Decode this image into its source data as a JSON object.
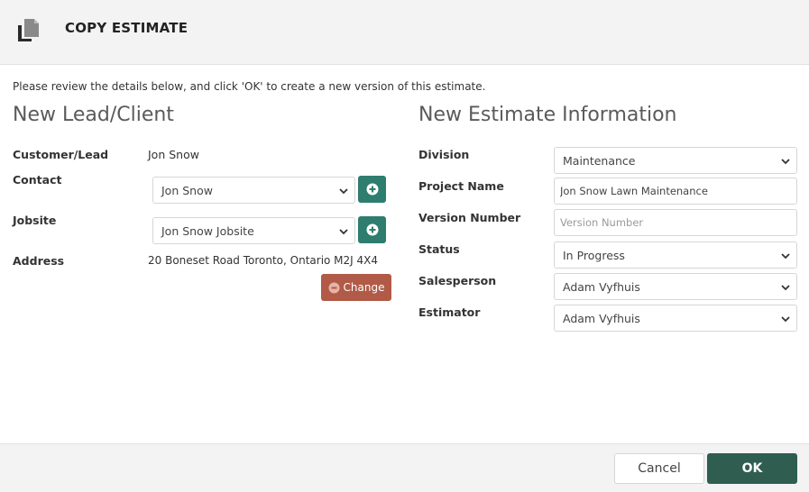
{
  "dialog": {
    "title": "COPY ESTIMATE",
    "icon": "copy-document-icon",
    "intro": "Please review the details below, and click 'OK' to create a new version of this estimate."
  },
  "lead_client": {
    "heading": "New Lead/Client",
    "customer_label": "Customer/Lead",
    "customer_value": "Jon Snow",
    "contact_label": "Contact",
    "contact_value": "Jon Snow",
    "jobsite_label": "Jobsite",
    "jobsite_value": "Jon Snow Jobsite",
    "address_label": "Address",
    "address_value": "20 Boneset Road Toronto, Ontario M2J 4X4",
    "change_label": "Change"
  },
  "estimate_info": {
    "heading": "New Estimate Information",
    "division_label": "Division",
    "division_value": "Maintenance",
    "project_label": "Project Name",
    "project_value": "Jon Snow Lawn Maintenance",
    "version_label": "Version Number",
    "version_placeholder": "Version Number",
    "status_label": "Status",
    "status_value": "In Progress",
    "salesperson_label": "Salesperson",
    "salesperson_value": "Adam Vyfhuis",
    "estimator_label": "Estimator",
    "estimator_value": "Adam Vyfhuis"
  },
  "footer": {
    "cancel_label": "Cancel",
    "ok_label": "OK"
  },
  "colors": {
    "add_button": "#2e7d6e",
    "change_button": "#b05a47",
    "ok_button": "#2f5d50",
    "header_bg": "#f3f3f3"
  }
}
